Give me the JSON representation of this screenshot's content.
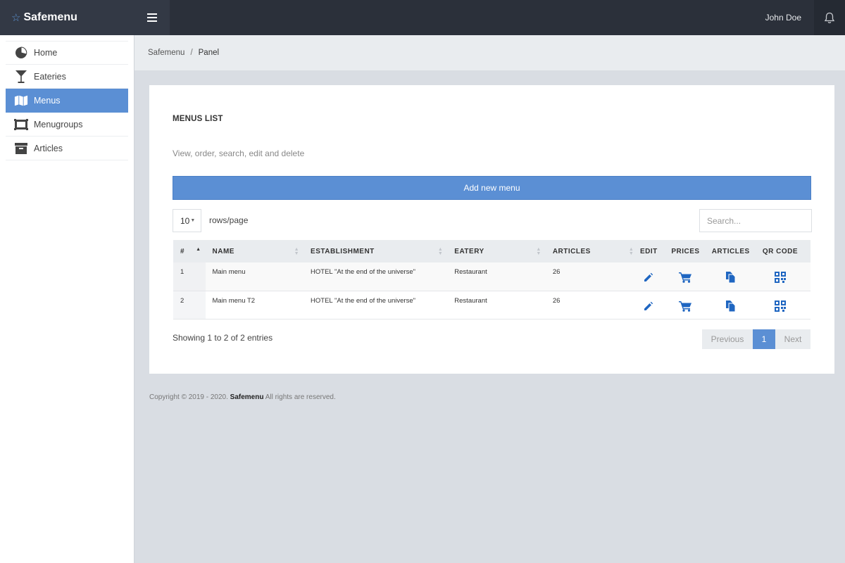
{
  "app": {
    "brand": "Safemenu",
    "brand_icon": "star-icon"
  },
  "topbar": {
    "user_name": "John Doe"
  },
  "sidebar": {
    "items": [
      {
        "label": "Home",
        "icon": "pie-chart-icon"
      },
      {
        "label": "Eateries",
        "icon": "cocktail-glass-icon"
      },
      {
        "label": "Menus",
        "icon": "map-icon",
        "active": true
      },
      {
        "label": "Menugroups",
        "icon": "frame-icon"
      },
      {
        "label": "Articles",
        "icon": "archive-box-icon"
      }
    ]
  },
  "breadcrumb": {
    "root": "Safemenu",
    "separator": "/",
    "current": "Panel"
  },
  "card": {
    "title": "MENUS LIST",
    "subtitle": "View, order, search, edit and delete",
    "add_button": "Add new menu"
  },
  "controls": {
    "rows_value": "10",
    "rows_label": "rows/page",
    "search_placeholder": "Search..."
  },
  "table": {
    "headers": [
      "#",
      "NAME",
      "ESTABLISHMENT",
      "EATERY",
      "ARTICLES",
      "EDIT",
      "PRICES",
      "ARTICLES",
      "QR CODE"
    ],
    "rows": [
      {
        "num": "1",
        "name": "Main menu",
        "establishment": "HOTEL \"At the end of the universe\"",
        "eatery": "Restaurant",
        "articles": "26"
      },
      {
        "num": "2",
        "name": "Main menu T2",
        "establishment": "HOTEL \"At the end of the universe\"",
        "eatery": "Restaurant",
        "articles": "26"
      }
    ]
  },
  "pagination": {
    "showing": "Showing 1 to 2 of 2 entries",
    "previous": "Previous",
    "page": "1",
    "next": "Next"
  },
  "footer": {
    "prefix": "Copyright © 2019 - 2020.",
    "brand": "Safemenu",
    "suffix": "All rights are reserved."
  },
  "colors": {
    "accent": "#5b8fd4",
    "topbar": "#2b303a",
    "icon_blue": "#1f66c1"
  }
}
